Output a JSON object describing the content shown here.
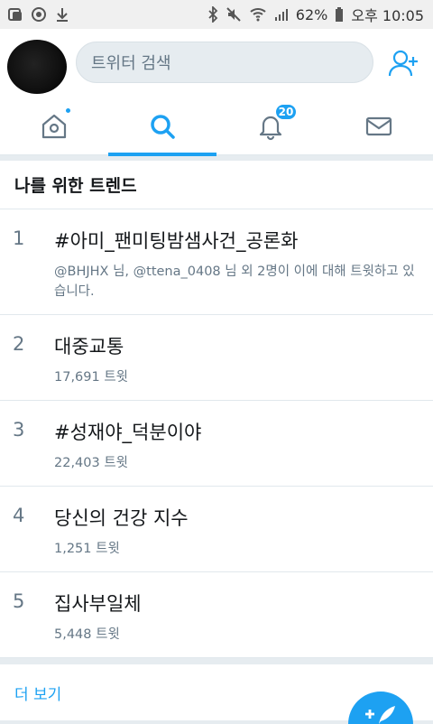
{
  "status_bar": {
    "battery": "62%",
    "time": "오후 10:05"
  },
  "header": {
    "search_placeholder": "트위터 검색"
  },
  "tabs": [
    {
      "icon": "home-icon"
    },
    {
      "icon": "search-icon",
      "active": true
    },
    {
      "icon": "bell-icon",
      "badge": "20"
    },
    {
      "icon": "mail-icon"
    }
  ],
  "section": {
    "title": "나를 위한 트렌드"
  },
  "trends": [
    {
      "rank": "1",
      "name": "#아미_팬미팅밤샘사건_공론화",
      "meta": "@BHJHX 님, @ttena_0408 님 외 2명이 이에 대해 트윗하고 있습니다."
    },
    {
      "rank": "2",
      "name": "대중교통",
      "meta": "17,691 트윗"
    },
    {
      "rank": "3",
      "name": "#성재야_덕분이야",
      "meta": "22,403 트윗"
    },
    {
      "rank": "4",
      "name": "당신의 건강 지수",
      "meta": "1,251 트윗"
    },
    {
      "rank": "5",
      "name": "집사부일체",
      "meta": "5,448 트윗"
    }
  ],
  "more": {
    "label": "더 보기"
  },
  "colors": {
    "accent": "#1da1f2",
    "text": "#14171a",
    "muted": "#657786"
  }
}
